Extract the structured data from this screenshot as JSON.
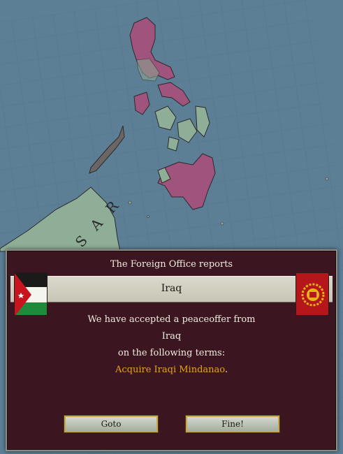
{
  "map": {
    "label": "S A R",
    "colors": {
      "sea": "#5c7f96",
      "grid": "#4b6d84",
      "magenta": "#a0537d",
      "green": "#8fae97",
      "gray": "#6b6664"
    }
  },
  "dialog": {
    "title": "The Foreign Office reports",
    "country_band": "Iraq",
    "line1": "We have accepted a peaceoffer from",
    "line2": "Iraq",
    "line3": "on the following terms:",
    "terms": "Acquire Iraqi Mindanao",
    "terms_suffix": ".",
    "buttons": {
      "goto": "Goto",
      "fine": "Fine!"
    },
    "flags": {
      "left": "jordan-style-flag-icon",
      "right": "red-emblem-flag-icon"
    }
  }
}
